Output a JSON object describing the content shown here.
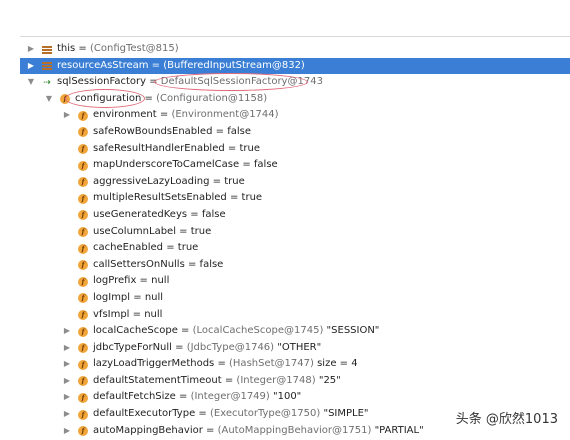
{
  "rows": [
    {
      "name": "this",
      "value": "(ConfigTest@815)",
      "icon": "stack-icon",
      "arrow": "▶"
    },
    {
      "name": "resourceAsStream",
      "value": "(BufferedInputStream@832)",
      "icon": "stack-icon",
      "arrow": "▶"
    },
    {
      "name": "sqlSessionFactory",
      "value": "DefaultSqlSessionFactory@1743",
      "icon": "static-field-icon",
      "arrow": "▼"
    },
    {
      "name": "configuration",
      "value": "(Configuration@1158)",
      "icon": "final-field-icon",
      "arrow": "▼"
    },
    {
      "name": "environment",
      "value": "(Environment@1744)",
      "icon": "field-icon",
      "arrow": "▶"
    },
    {
      "name": "safeRowBoundsEnabled",
      "value": "false",
      "icon": "field-icon",
      "arrow": ""
    },
    {
      "name": "safeResultHandlerEnabled",
      "value": "true",
      "icon": "field-icon",
      "arrow": ""
    },
    {
      "name": "mapUnderscoreToCamelCase",
      "value": "false",
      "icon": "field-icon",
      "arrow": ""
    },
    {
      "name": "aggressiveLazyLoading",
      "value": "true",
      "icon": "field-icon",
      "arrow": ""
    },
    {
      "name": "multipleResultSetsEnabled",
      "value": "true",
      "icon": "field-icon",
      "arrow": ""
    },
    {
      "name": "useGeneratedKeys",
      "value": "false",
      "icon": "field-icon",
      "arrow": ""
    },
    {
      "name": "useColumnLabel",
      "value": "true",
      "icon": "field-icon",
      "arrow": ""
    },
    {
      "name": "cacheEnabled",
      "value": "true",
      "icon": "field-icon",
      "arrow": ""
    },
    {
      "name": "callSettersOnNulls",
      "value": "false",
      "icon": "field-icon",
      "arrow": ""
    },
    {
      "name": "logPrefix",
      "value": "null",
      "icon": "field-icon",
      "arrow": ""
    },
    {
      "name": "logImpl",
      "value": "null",
      "icon": "field-icon",
      "arrow": ""
    },
    {
      "name": "vfsImpl",
      "value": "null",
      "icon": "field-icon",
      "arrow": ""
    },
    {
      "name": "localCacheScope",
      "value": "(LocalCacheScope@1745)",
      "extra": "\"SESSION\"",
      "icon": "field-icon",
      "arrow": "▶"
    },
    {
      "name": "jdbcTypeForNull",
      "value": "(JdbcType@1746)",
      "extra": "\"OTHER\"",
      "icon": "field-icon",
      "arrow": "▶"
    },
    {
      "name": "lazyLoadTriggerMethods",
      "value": "(HashSet@1747)",
      "extra": "size = 4",
      "icon": "field-icon",
      "arrow": "▶"
    },
    {
      "name": "defaultStatementTimeout",
      "value": "(Integer@1748)",
      "extra": "\"25\"",
      "icon": "field-icon",
      "arrow": "▶"
    },
    {
      "name": "defaultFetchSize",
      "value": "(Integer@1749)",
      "extra": "\"100\"",
      "icon": "field-icon",
      "arrow": "▶"
    },
    {
      "name": "defaultExecutorType",
      "value": "(ExecutorType@1750)",
      "extra": "\"SIMPLE\"",
      "icon": "field-icon",
      "arrow": "▶"
    },
    {
      "name": "autoMappingBehavior",
      "value": "(AutoMappingBehavior@1751)",
      "extra": "\"PARTIAL\"",
      "icon": "field-icon",
      "arrow": "▶"
    }
  ],
  "selected_index": 1,
  "watermark": "头条 @欣然1013",
  "colors": {
    "selection": "#3a7fd5",
    "field_icon": "#f0a63b",
    "annotation": "#e06c7b"
  }
}
